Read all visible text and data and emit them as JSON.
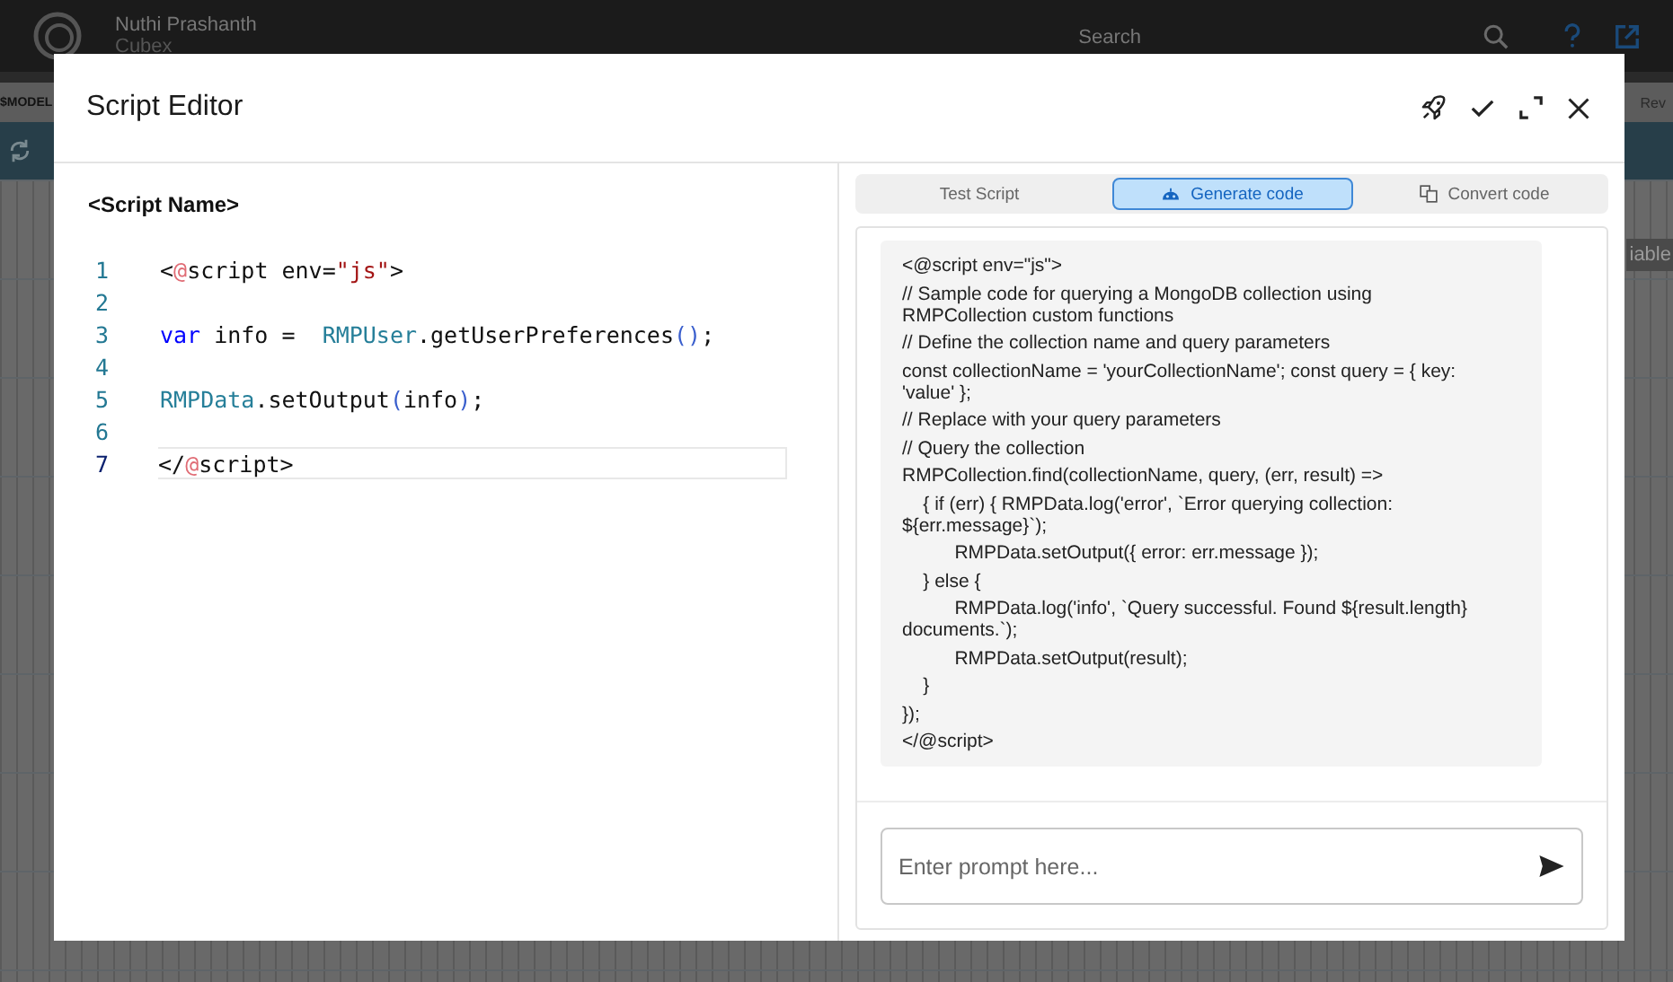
{
  "app_bar": {
    "user_name": "Nuthi Prashanth",
    "org": "Cubex",
    "search": "Search"
  },
  "toolbar": {
    "left_label": "$MODEL",
    "right_label": "Rev"
  },
  "background_button": "iable",
  "dialog": {
    "title": "Script Editor",
    "script_name": "<Script Name>",
    "code_lines": [
      {
        "number": "1",
        "active": false,
        "tokens": [
          {
            "kind": "plain",
            "text": "<"
          },
          {
            "kind": "at",
            "text": "@"
          },
          {
            "kind": "plain",
            "text": "script env="
          },
          {
            "kind": "string",
            "text": "\"js\""
          },
          {
            "kind": "plain",
            "text": ">"
          }
        ]
      },
      {
        "number": "2",
        "active": false
      },
      {
        "number": "3",
        "active": false,
        "tokens": [
          {
            "kind": "keyword",
            "text": "var"
          },
          {
            "kind": "plain",
            "text": " info =  "
          },
          {
            "kind": "class",
            "text": "RMPUser"
          },
          {
            "kind": "plain",
            "text": ".getUserPreferences"
          },
          {
            "kind": "paren",
            "text": "()"
          },
          {
            "kind": "plain",
            "text": ";"
          }
        ]
      },
      {
        "number": "4",
        "active": false
      },
      {
        "number": "5",
        "active": false,
        "tokens": [
          {
            "kind": "class",
            "text": "RMPData"
          },
          {
            "kind": "plain",
            "text": ".setOutput"
          },
          {
            "kind": "paren",
            "text": "("
          },
          {
            "kind": "plain",
            "text": "info"
          },
          {
            "kind": "paren",
            "text": ")"
          },
          {
            "kind": "plain",
            "text": ";"
          }
        ]
      },
      {
        "number": "6",
        "active": false
      },
      {
        "number": "7",
        "active": true,
        "tokens": [
          {
            "kind": "plain",
            "text": "</"
          },
          {
            "kind": "at",
            "text": "@"
          },
          {
            "kind": "plain",
            "text": "script>"
          }
        ]
      }
    ],
    "tabs": [
      {
        "label": "Test Script",
        "selected": false,
        "kind": "plain"
      },
      {
        "label": "Generate code",
        "selected": true,
        "kind": "generate"
      },
      {
        "label": "Convert code",
        "selected": false,
        "kind": "convert"
      }
    ],
    "generated_code": [
      "<@script env=\"js\">",
      "// Sample code for querying a MongoDB collection using RMPCollection custom functions",
      "// Define the collection name and query parameters",
      "const collectionName = 'yourCollectionName'; const query = { key: 'value' };",
      "// Replace with your query parameters",
      "// Query the collection",
      "RMPCollection.find(collectionName, query, (err, result) =>",
      "    { if (err) { RMPData.log('error', `Error querying collection: ${err.message}`);",
      "          RMPData.setOutput({ error: err.message });",
      "    } else {",
      "          RMPData.log('info', `Query successful. Found ${result.length} documents.`);",
      "          RMPData.setOutput(result);",
      "    }",
      "});",
      "</@script>"
    ],
    "prompt": {
      "placeholder": "Enter prompt here..."
    }
  }
}
